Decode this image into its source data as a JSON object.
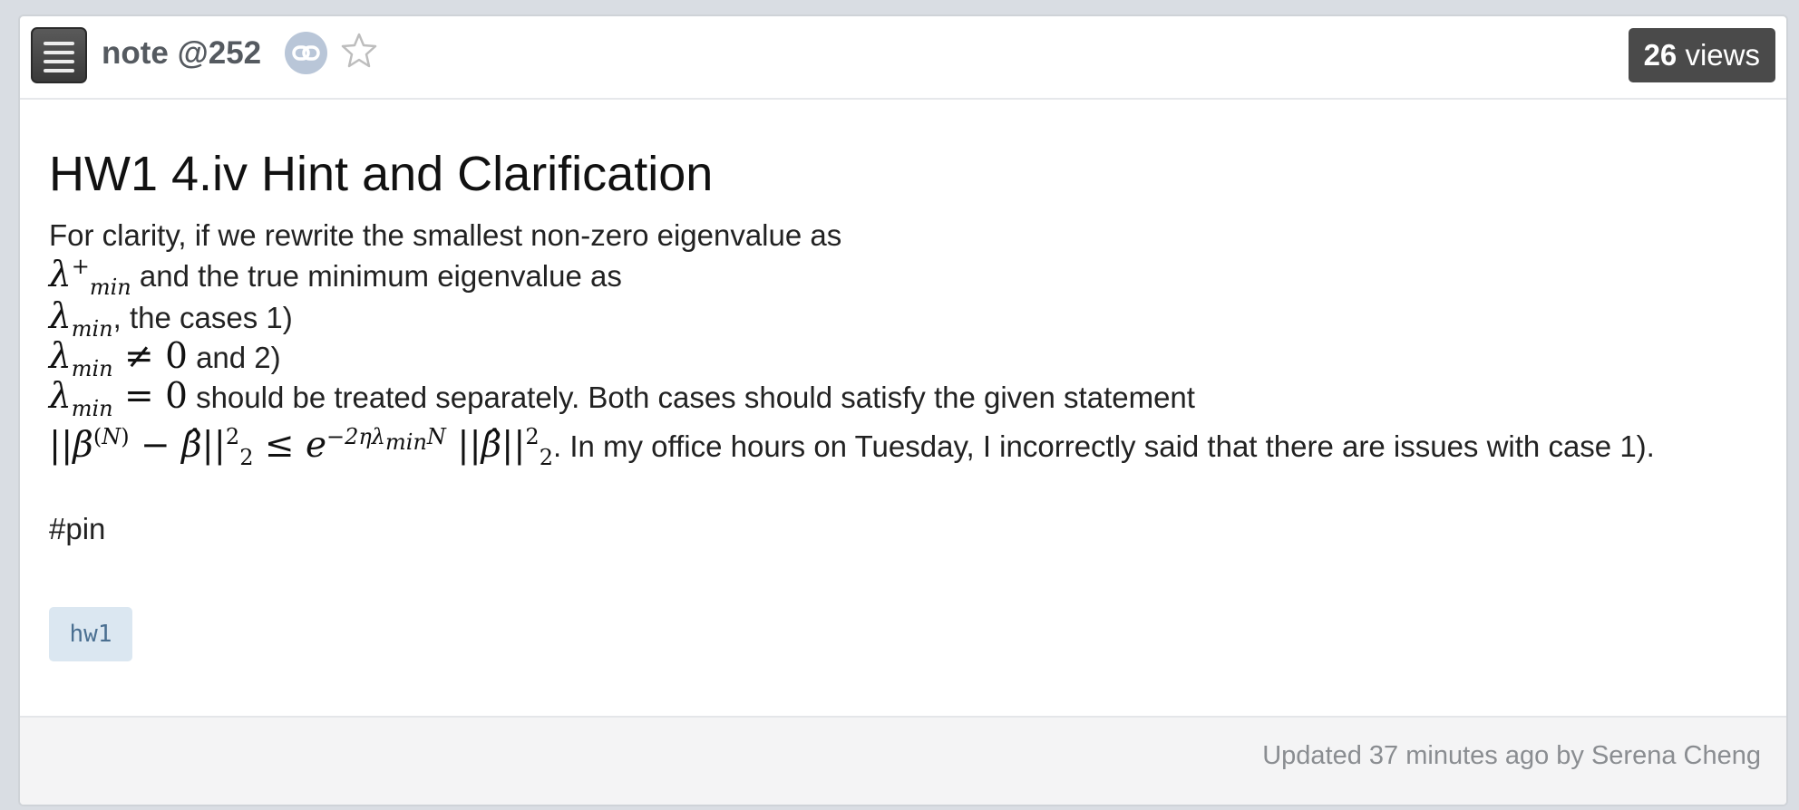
{
  "header": {
    "note_label": "note @252",
    "views_count": "26",
    "views_word": "views",
    "icons": [
      "menu-icon",
      "link-icon",
      "star-icon"
    ]
  },
  "post": {
    "title": "HW1 4.iv Hint and Clarification",
    "line1": "For clarity, if we rewrite the smallest non-zero eigenvalue as",
    "line2_text": "and the true minimum eigenvalue as",
    "line3_text": ", the cases 1)",
    "line4_text": "and 2)",
    "line5_text": "should be treated separately. Both cases should satisfy the given statement",
    "line6_text": ". In my office hours on Tuesday, I incorrectly said that there are issues with case 1).",
    "pin": "#pin"
  },
  "tags": [
    "hw1"
  ],
  "footer": {
    "updated_text": "Updated 37 minutes ago by Serena Cheng"
  },
  "colors": {
    "menu_button": "#4a4a4a",
    "views_badge": "#4a4a4a",
    "link_button": "#b9c6d8",
    "tag_bg": "#dbe7f1",
    "tag_text": "#4a6f91"
  }
}
